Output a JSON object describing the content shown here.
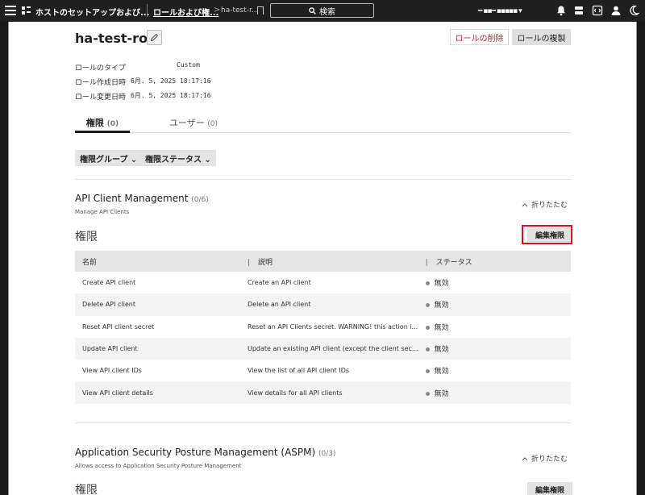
{
  "topbar": {
    "app_title": "ホストのセットアップおよび...",
    "crumb_1": "ロールおよび権...",
    "crumb_sep": ">",
    "crumb_2": "ha-test-r...",
    "search_label": "検索",
    "account": "━ ▪▪━ ▪▪▪▪▪ ▾"
  },
  "role": {
    "name": "ha-test-roll",
    "delete_label": "ロールの削除",
    "duplicate_label": "ロールの複製",
    "type_label": "ロールのタイプ",
    "type_value": "Custom",
    "created_label": "ロール作成日時",
    "created_value": "6月. 5, 2025 18:17:16",
    "modified_label": "ロール変更日時",
    "modified_value": "6月. 5, 2025 18:17:16"
  },
  "tabs": [
    {
      "label": "権限",
      "count": "(0)"
    },
    {
      "label": "ユーザー",
      "count": "(0)"
    }
  ],
  "filters": {
    "group": "権限グループ ⌄",
    "status": "権限ステータス ⌄"
  },
  "sections": [
    {
      "title": "API Client Management",
      "count": "(0/6)",
      "description": "Manage API Clients",
      "collapse_label": "折りたたむ",
      "perm_heading": "権限",
      "edit_label": "編集権限",
      "columns": [
        "名前",
        "説明",
        "ステータス"
      ],
      "rows": [
        {
          "name": "Create API client",
          "desc": "Create an API client",
          "status": "無効"
        },
        {
          "name": "Delete API client",
          "desc": "Delete an API client",
          "status": "無効"
        },
        {
          "name": "Reset API client secret",
          "desc": "Reset an API Clients secret. WARNING! this action i...",
          "status": "無効"
        },
        {
          "name": "Update API client",
          "desc": "Update an existing API client (except the client sec...",
          "status": "無効"
        },
        {
          "name": "View API client IDs",
          "desc": "View the list of all API client IDs",
          "status": "無効"
        },
        {
          "name": "View API client details",
          "desc": "View details for all API clients",
          "status": "無効"
        }
      ]
    },
    {
      "title": "Application Security Posture Management (ASPM)",
      "count": "(0/3)",
      "description": "Allows access to Application Security Posture Management",
      "collapse_label": "折りたたむ",
      "perm_heading": "権限",
      "edit_label": "編集権限"
    }
  ],
  "colors": {
    "topbar_bg": "#1f1f1f",
    "danger": "#c5222a",
    "highlight_box": "#d9141c"
  }
}
